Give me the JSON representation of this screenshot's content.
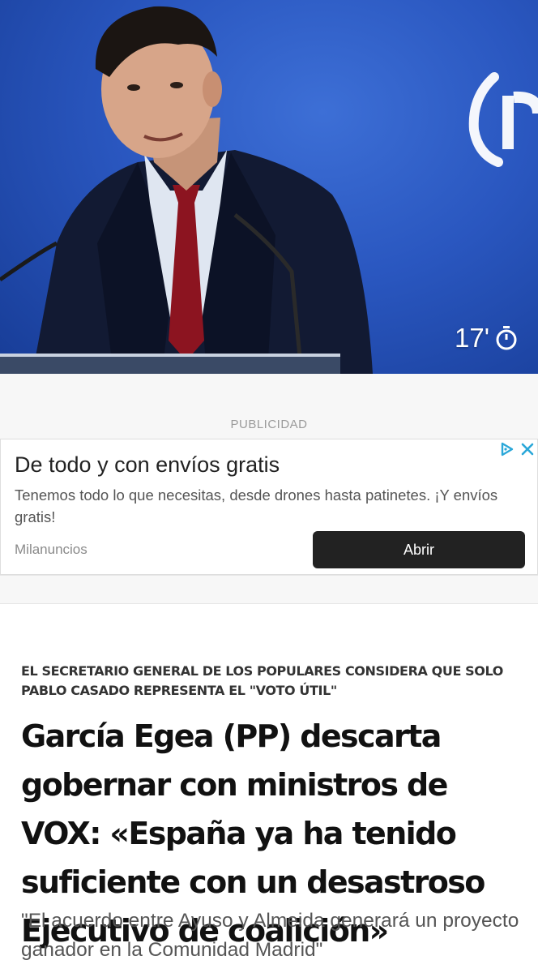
{
  "hero": {
    "read_time": "17'",
    "icons": {
      "timer": "stopwatch-icon"
    }
  },
  "ad": {
    "label": "PUBLICIDAD",
    "headline": "De todo y con envíos gratis",
    "description": "Tenemos todo lo que necesitas, desde drones hasta patinetes. ¡Y envíos gratis!",
    "source": "Milanuncios",
    "cta": "Abrir",
    "icons": {
      "adchoices": "adchoices-icon",
      "close": "close-icon"
    }
  },
  "article": {
    "kicker": "EL SECRETARIO GENERAL DE LOS POPULARES CONSIDERA QUE SOLO PABLO CASADO REPRESENTA EL \"VOTO ÚTIL\"",
    "headline": "García Egea (PP) descarta gobernar con ministros de VOX: «España ya ha tenido suficiente con un desastroso Ejecutivo de coalición»",
    "subtitle": "\"El acuerdo entre Ayuso y Almeida generará un proyecto ganador en la Comunidad Madrid\""
  },
  "colors": {
    "hero_blue": "#2a57c0",
    "button_bg": "#222222",
    "adchoices": "#2aa7d8"
  }
}
